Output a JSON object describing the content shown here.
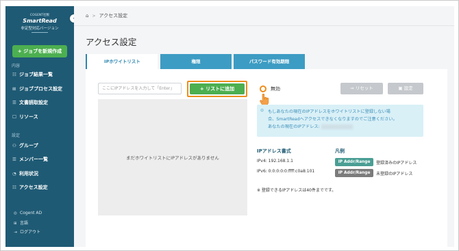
{
  "sidebar": {
    "brand_small": "COGENT社製",
    "brand": "SmartRead",
    "brand_sub": "非定型対応バージョン",
    "collapse_icon": "‹",
    "new_job_label": "+ ジョブを新規作成",
    "section_content": "内容",
    "nav_content": [
      {
        "icon": "☷",
        "label": "ジョブ結果一覧"
      },
      {
        "icon": "⊞",
        "label": "ジョブプロセス設定"
      },
      {
        "icon": "☰",
        "label": "文書読取設定"
      },
      {
        "icon": "☐",
        "label": "リソース"
      }
    ],
    "section_settings": "設定",
    "nav_settings": [
      {
        "icon": "⚇",
        "label": "グループ"
      },
      {
        "icon": "☰",
        "label": "メンバー一覧"
      },
      {
        "icon": "◔",
        "label": "利用状況"
      },
      {
        "icon": "☷",
        "label": "アクセス設定"
      }
    ],
    "footer": [
      {
        "icon": "◎",
        "label": "Cogent AD"
      },
      {
        "icon": "⊞",
        "label": "言語"
      },
      {
        "icon": "⇥",
        "label": "ログアウト"
      }
    ]
  },
  "header": {
    "home_icon": "⌂",
    "separator": ">",
    "breadcrumb_current": "アクセス設定"
  },
  "page_title": "アクセス設定",
  "tabs": [
    {
      "label": "IPホワイトリスト",
      "active": true
    },
    {
      "label": "権限",
      "active": false
    },
    {
      "label": "パスワード有効期限",
      "active": false
    }
  ],
  "whitelist": {
    "input_placeholder": "ここにIPアドレスを入力して「Enter」",
    "add_button": "+ リストに追加",
    "empty_message": "まだホワイトリストにIPアドレスがありません",
    "toggle_label": "無効",
    "reset_button": "⇒ リセット",
    "setting_button": "▣ 設定",
    "info_icon": "⊙",
    "info_lines": [
      "もしあなたの現在のIPアドレスをホワイトリストに登録しない場",
      "合、SmartReadへアクセスできなくなりますのでご注意ください。",
      "あなたの現在のIPアドレス:"
    ],
    "format_title": "IPアドレス書式",
    "format_examples": [
      "IPv4: 192.168.1.1",
      "IPv6: 0:0:0:0:0:ffff:c0a8:101"
    ],
    "legend_title": "凡例",
    "legend": [
      {
        "badge": "IP Addr/Range",
        "text": "登録済みのIPアドレス",
        "color": "#4a9e94"
      },
      {
        "badge": "IP Addr/Range",
        "text": "未登録のIPアドレス",
        "color": "#7b7b7b"
      }
    ],
    "note": "※ 登録できるIPアドレスは40件までです。"
  },
  "colors": {
    "sidebar": "#1f5a74",
    "accent_green": "#4caf50",
    "highlight_orange": "#ef8d1d",
    "tab_blue": "#3d9cc3"
  }
}
